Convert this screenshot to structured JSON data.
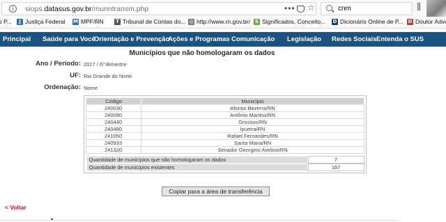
{
  "browser": {
    "url_prefix": "siops.",
    "url_domain": "datasus.gov.br",
    "url_suffix": "/munntransm.php",
    "url_more": "•••",
    "search_value": "cnm",
    "bookmarks": [
      {
        "label": "o P...",
        "color": "#8a8a8a",
        "glyph": ""
      },
      {
        "label": "Justiça Federal",
        "color": "#2f6db5",
        "glyph": "J"
      },
      {
        "label": "MPF/RN",
        "color": "#2f6db5",
        "glyph": "M"
      },
      {
        "label": "Tribunal de Contas do...",
        "color": "#555555",
        "glyph": "T"
      },
      {
        "label": "http://www.rn.gov.br/",
        "color": "#7a7a7a",
        "glyph": "◎"
      },
      {
        "label": "Significados, Conceito...",
        "color": "#6aa84f",
        "glyph": "S"
      },
      {
        "label": "Dicionário Online de P...",
        "color": "#1b3d7a",
        "glyph": "D"
      },
      {
        "label": "Doutor Advo",
        "color": "#c0392b",
        "glyph": "D"
      }
    ]
  },
  "nav": {
    "items": [
      "Principal",
      "Saúde para Você",
      "Orientação e Prevenção",
      "Ações e Programas",
      "Comunicação",
      "Legislação",
      "Redes Sociais",
      "Entenda o SUS"
    ]
  },
  "page": {
    "title": "Municípios que não homologaram os dados",
    "period_label": "Ano / Período:",
    "period_value": "2017 / 6º Bimestre",
    "uf_label": "UF:",
    "uf_value": "Rio Grande do Norte",
    "order_label": "Ordenação:",
    "order_value": "Nome"
  },
  "table": {
    "headers": [
      "Código",
      "Município"
    ],
    "rows": [
      [
        "240030",
        "Afonso Bezerra/RN"
      ],
      [
        "240090",
        "Antônio Martins/RN"
      ],
      [
        "240440",
        "Grossos/RN"
      ],
      [
        "240480",
        "Ipueira/RN"
      ],
      [
        "241050",
        "Rafael Fernandes/RN"
      ],
      [
        "240933",
        "Santa Maria/RN"
      ],
      [
        "241320",
        "Senador Georgino Avelino/RN"
      ]
    ],
    "summary": [
      {
        "label": "Quantidade de municípios que não homologaram os dados",
        "value": "7"
      },
      {
        "label": "Quantidade de municípios existentes",
        "value": "167"
      }
    ]
  },
  "actions": {
    "copy_label": "Copiar para a área de transferência",
    "back_label": "< Voltar"
  },
  "colors": {
    "nav_bg": "#1b5380",
    "back_link": "#cc1111"
  }
}
